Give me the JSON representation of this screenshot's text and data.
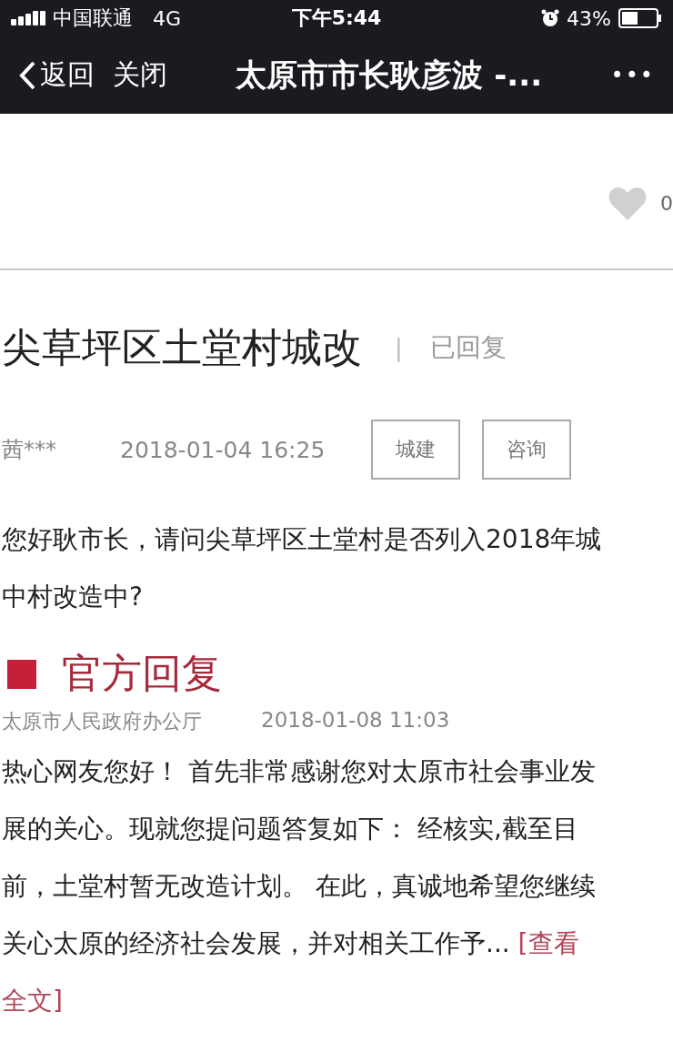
{
  "status_bar": {
    "carrier": "中国联通",
    "network": "4G",
    "time": "下午5:44",
    "battery": "43%"
  },
  "nav": {
    "back": "返回",
    "close": "关闭",
    "title": "太原市市长耿彦波 -...",
    "more": "•••"
  },
  "previous_item": {
    "likes": "0",
    "liked": false
  },
  "post": {
    "title": "尖草坪区土堂村城改",
    "separator": "|",
    "status": "已回复",
    "author": "茜***",
    "date": "2018-01-04 16:25",
    "tags": [
      "城建",
      "咨询"
    ],
    "question": [
      "您好耿市长，请问尖草坪区土堂村是否列入2018年城",
      "中村改造中?"
    ]
  },
  "reply": {
    "heading": "官方回复",
    "department": "太原市人民政府办公厅",
    "date": "2018-01-08 11:03",
    "lines": [
      "热心网友您好！ 首先非常感谢您对太原市社会事业发",
      "展的关心。现就您提问题答复如下： 经核实,截至目",
      "前，土堂村暂无改造计划。 在此，真诚地希望您继续",
      "关心太原的经济社会发展，并对相关工作予... "
    ],
    "more_link": [
      "[查看",
      "全文]"
    ]
  }
}
